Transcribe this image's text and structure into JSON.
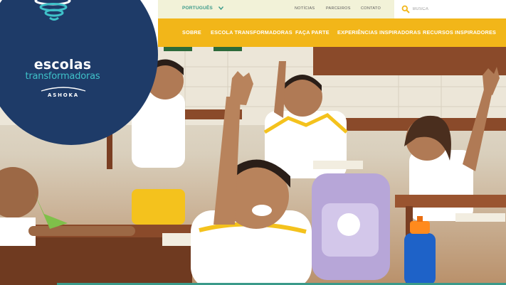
{
  "topbar": {
    "language": "PORTUGUÊS",
    "links": [
      "NOTÍCIAS",
      "PARCEIROS",
      "CONTATO"
    ],
    "search_placeholder": "BUSCA"
  },
  "mainnav": {
    "items": [
      "SOBRE",
      "ESCOLA TRANSFORMADORAS",
      "FAÇA PARTE",
      "EXPERIÊNCIAS INSPIRADORAS",
      "RECURSOS INSPIRADORES"
    ]
  },
  "logo": {
    "line1": "escolas",
    "line2": "transformadoras",
    "line3": "ASHOKA"
  },
  "colors": {
    "navy": "#1e3b68",
    "teal": "#3fc1c9",
    "nav_yellow": "#f2b619",
    "topbar_bg": "#f2f2d8"
  },
  "icons": [
    "search-icon",
    "chevron-down-icon",
    "swirl-logo-icon"
  ],
  "hero": {
    "description_alt": ""
  }
}
